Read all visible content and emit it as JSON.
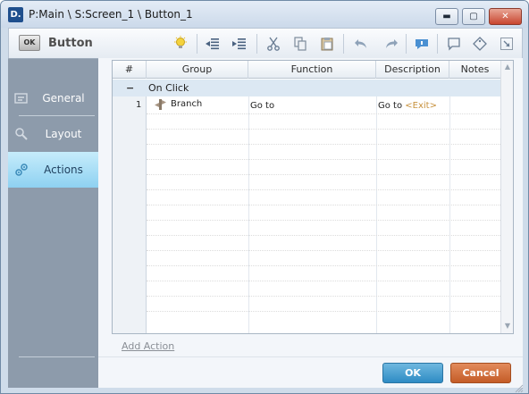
{
  "window": {
    "app_icon_text": "D.",
    "title": "P:Main \\ S:Screen_1 \\ Button_1",
    "min_glyph": "▬",
    "max_glyph": "▢",
    "close_glyph": "✕"
  },
  "toolbar": {
    "badge": "OK",
    "title": "Button",
    "icons": [
      "lightbulb-icon",
      "outdent-icon",
      "indent-icon",
      "cut-icon",
      "copy-icon",
      "paste-icon",
      "undo-icon",
      "redo-icon",
      "comment-icon",
      "note-icon",
      "tag-icon",
      "expand-icon"
    ]
  },
  "sidebar": {
    "items": [
      {
        "label": "General",
        "icon": "general-icon",
        "active": false
      },
      {
        "label": "Layout",
        "icon": "layout-icon",
        "active": false
      },
      {
        "label": "Actions",
        "icon": "actions-icon",
        "active": true
      }
    ]
  },
  "grid": {
    "columns": [
      "#",
      "Group",
      "Function",
      "Description",
      "Notes"
    ],
    "group_toggle": "−",
    "group_label": "On Click",
    "rows": [
      {
        "num": "1",
        "group": "Branch",
        "function": "Go to",
        "description_prefix": "Go to ",
        "description_target": "<Exit>",
        "notes": ""
      }
    ]
  },
  "add_action": "Add Action",
  "buttons": {
    "ok": "OK",
    "cancel": "Cancel"
  },
  "colors": {
    "accent": "#8ed1f1",
    "ok": "#2e8cc4",
    "cancel": "#c45c27",
    "exit_text": "#c7913c"
  }
}
